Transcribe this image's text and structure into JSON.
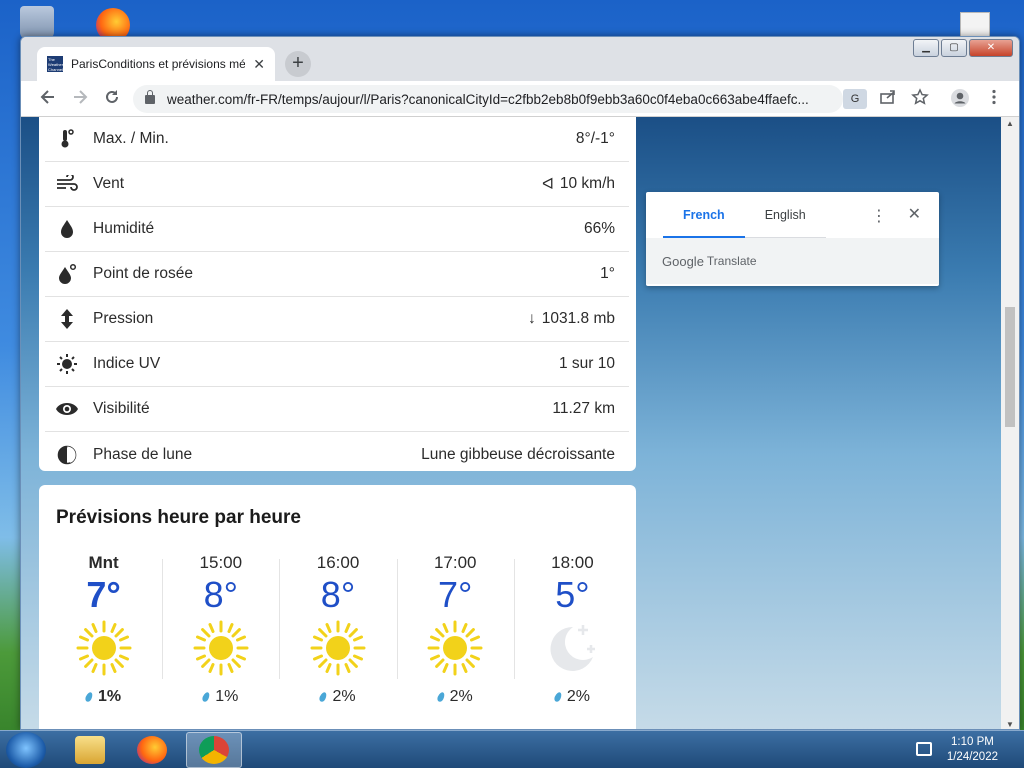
{
  "browser": {
    "tab_title": "ParisConditions et prévisions mé",
    "favicon_text": "The Weather Channel",
    "url": "weather.com/fr-FR/temps/aujour/l/Paris?canonicalCityId=c2fbb2eb8b0f9ebb3a60c0f4eba0c663abe4ffaefc...",
    "translate_icon_label": "G",
    "new_tab_label": "+",
    "tab_close_label": "✕",
    "window_controls": {
      "minimize": "▁",
      "maximize": "▢",
      "close": "✕"
    }
  },
  "details": [
    {
      "label": "Max. / Min.",
      "value": "8°/-1°",
      "icon": "thermometer-icon"
    },
    {
      "label": "Vent",
      "value": "10 km/h",
      "prefix": "ᐊ",
      "icon": "wind-icon"
    },
    {
      "label": "Humidité",
      "value": "66%",
      "icon": "humidity-drop-icon"
    },
    {
      "label": "Point de rosée",
      "value": "1°",
      "icon": "dew-point-icon"
    },
    {
      "label": "Pression",
      "value": "1031.8 mb",
      "prefix": "↓",
      "icon": "pressure-icon"
    },
    {
      "label": "Indice UV",
      "value": "1 sur 10",
      "icon": "uv-sun-icon"
    },
    {
      "label": "Visibilité",
      "value": "11.27 km",
      "icon": "eye-icon"
    },
    {
      "label": "Phase de lune",
      "value": "Lune gibbeuse décroissante",
      "icon": "moon-phase-icon"
    }
  ],
  "hourly": {
    "title": "Prévisions heure par heure",
    "hours": [
      {
        "time": "Mnt",
        "temp": "7°",
        "precip": "1%",
        "icon": "sun-icon"
      },
      {
        "time": "15:00",
        "temp": "8°",
        "precip": "1%",
        "icon": "sun-icon"
      },
      {
        "time": "16:00",
        "temp": "8°",
        "precip": "2%",
        "icon": "sun-icon"
      },
      {
        "time": "17:00",
        "temp": "7°",
        "precip": "2%",
        "icon": "sun-icon"
      },
      {
        "time": "18:00",
        "temp": "5°",
        "precip": "2%",
        "icon": "clear-night-moon-icon"
      }
    ]
  },
  "translate_popup": {
    "tab_source": "French",
    "tab_target": "English",
    "brand_google": "Google",
    "brand_translate": "Translate",
    "menu_label": "⋮",
    "close_label": "✕"
  },
  "taskbar": {
    "time": "1:10 PM",
    "date": "1/24/2022"
  },
  "colors": {
    "temp_blue": "#1f4fc7",
    "sun_yellow": "#f2d21a",
    "accent_blue": "#1a73e8"
  }
}
